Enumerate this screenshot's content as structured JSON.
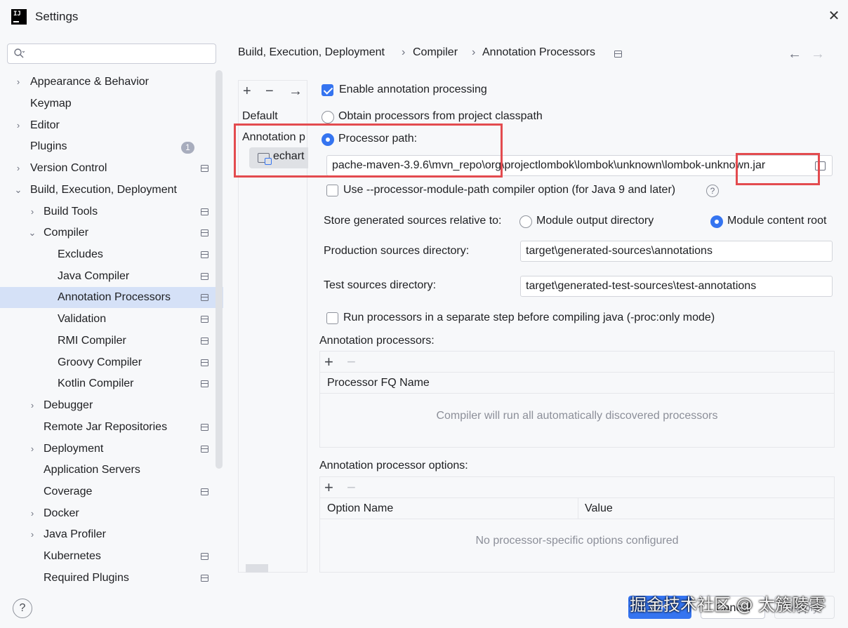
{
  "window": {
    "title": "Settings",
    "logo_text": "IJ"
  },
  "search": {
    "placeholder": ""
  },
  "sidebar": {
    "items": [
      {
        "label": "Appearance & Behavior"
      },
      {
        "label": "Keymap"
      },
      {
        "label": "Editor"
      },
      {
        "label": "Plugins",
        "badge": "1"
      },
      {
        "label": "Version Control"
      },
      {
        "label": "Build, Execution, Deployment"
      },
      {
        "label": "Build Tools"
      },
      {
        "label": "Compiler"
      },
      {
        "label": "Excludes"
      },
      {
        "label": "Java Compiler"
      },
      {
        "label": "Annotation Processors"
      },
      {
        "label": "Validation"
      },
      {
        "label": "RMI Compiler"
      },
      {
        "label": "Groovy Compiler"
      },
      {
        "label": "Kotlin Compiler"
      },
      {
        "label": "Debugger"
      },
      {
        "label": "Remote Jar Repositories"
      },
      {
        "label": "Deployment"
      },
      {
        "label": "Application Servers"
      },
      {
        "label": "Coverage"
      },
      {
        "label": "Docker"
      },
      {
        "label": "Java Profiler"
      },
      {
        "label": "Kubernetes"
      },
      {
        "label": "Required Plugins"
      }
    ]
  },
  "breadcrumb": {
    "items": [
      "Build, Execution, Deployment",
      "Compiler",
      "Annotation Processors"
    ],
    "separator": "›"
  },
  "profiles": {
    "add": "+",
    "remove": "−",
    "move": "→",
    "default_label": "Default",
    "annotation_label": "Annotation p",
    "module_label": "echart"
  },
  "main": {
    "enable_label": "Enable annotation processing",
    "obtain_label": "Obtain processors from project classpath",
    "processor_path_label": "Processor path:",
    "processor_path_value": "pache-maven-3.9.6\\mvn_repo\\org\\projectlombok\\lombok\\unknown\\lombok-unknown.jar",
    "module_path_label": "Use --processor-module-path compiler option (for Java 9 and later)",
    "store_label": "Store generated sources relative to:",
    "module_output_label": "Module output directory",
    "module_content_label": "Module content root",
    "prod_dir_label": "Production sources directory:",
    "prod_dir_value": "target\\generated-sources\\annotations",
    "test_dir_label": "Test sources directory:",
    "test_dir_value": "target\\generated-test-sources\\test-annotations",
    "run_separate_label": "Run processors in a separate step before compiling java (-proc:only mode)",
    "processors_title": "Annotation processors:",
    "processors_col": "Processor FQ Name",
    "processors_empty": "Compiler will run all automatically discovered processors",
    "options_title": "Annotation processor options:",
    "options_col_name": "Option Name",
    "options_col_value": "Value",
    "options_empty": "No processor-specific options configured",
    "help_glyph": "?"
  },
  "footer": {
    "ok": "OK",
    "cancel": "Cancel",
    "apply": "Apply",
    "help": "?"
  },
  "watermark": "掘金技术社区 @ 太簇陵零",
  "colors": {
    "accent": "#3574f0",
    "highlight": "#e34b4f",
    "selection": "#d5e1f7"
  }
}
